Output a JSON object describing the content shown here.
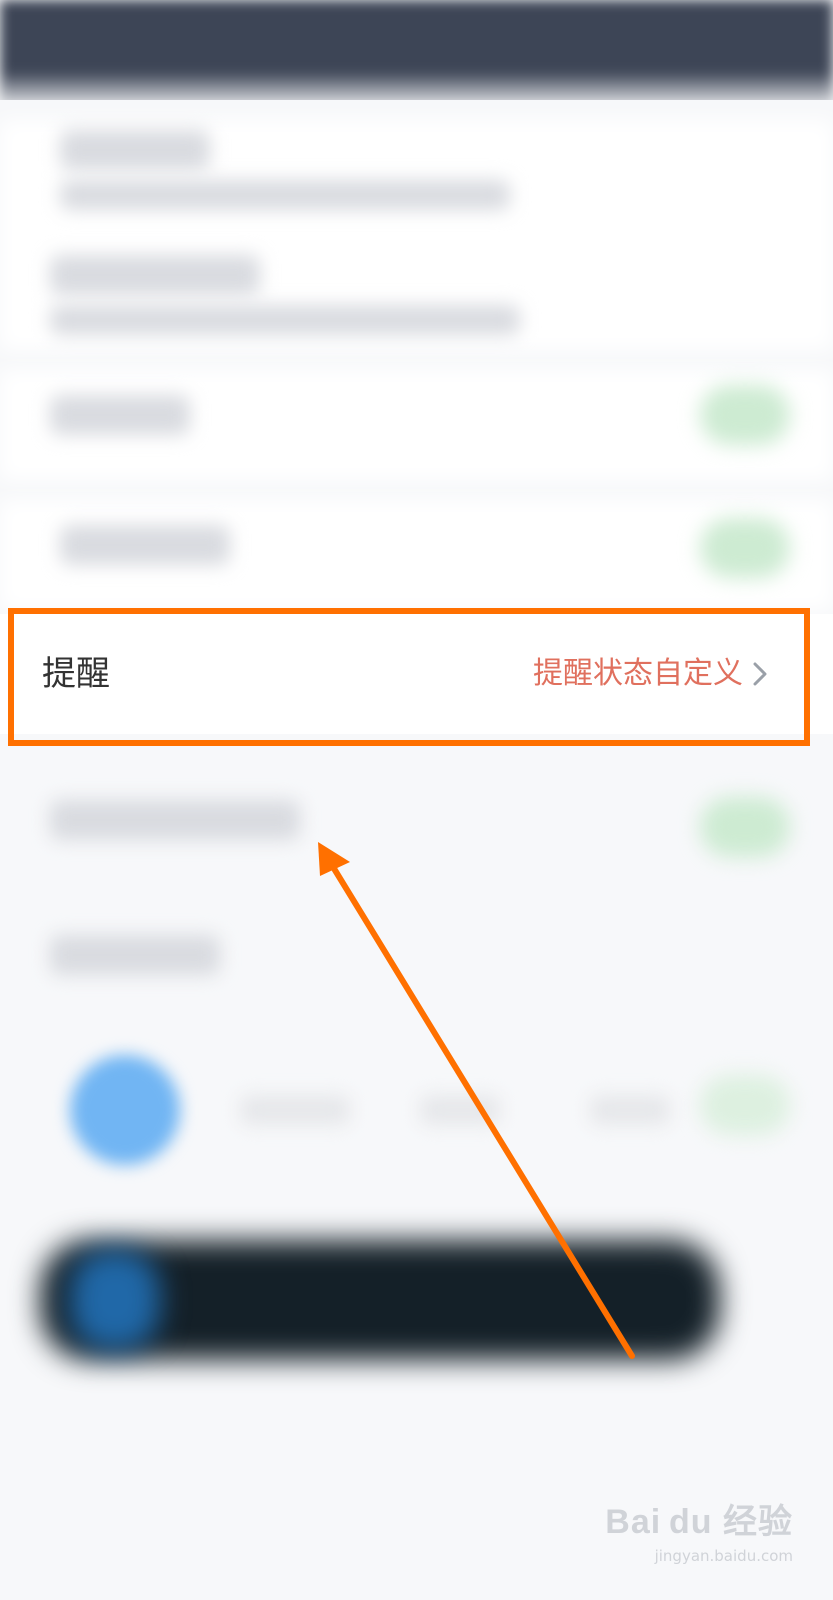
{
  "reminder_row": {
    "label": "提醒",
    "value": "提醒状态自定义",
    "chevron_icon": "chevron-right-icon"
  },
  "annotation": {
    "highlight_color": "#ff7000",
    "arrow_color": "#ff7000"
  },
  "watermark": {
    "brand": "Bai du 经验",
    "url": "jingyan.baidu.com"
  }
}
